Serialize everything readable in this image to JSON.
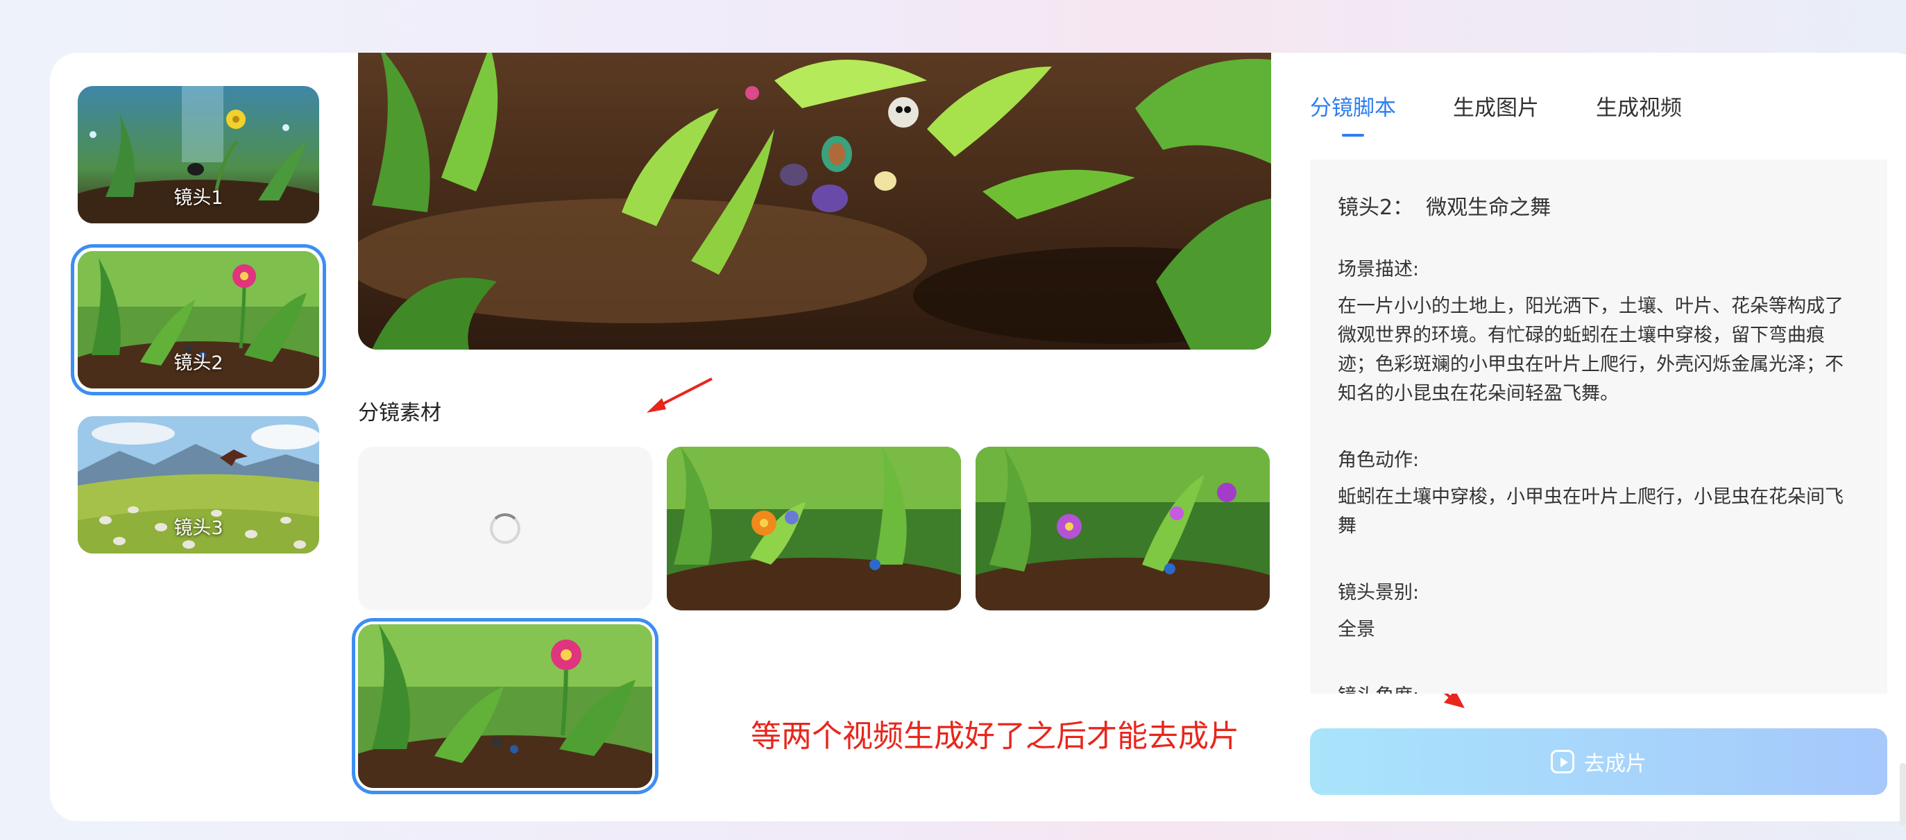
{
  "shots": [
    {
      "label": "镜头1"
    },
    {
      "label": "镜头2"
    },
    {
      "label": "镜头3"
    }
  ],
  "materials": {
    "title": "分镜素材"
  },
  "annotation": {
    "note": "等两个视频生成好了之后才能去成片",
    "color": "#e8261c"
  },
  "tabs": [
    {
      "label": "分镜脚本",
      "active": true
    },
    {
      "label": "生成图片",
      "active": false
    },
    {
      "label": "生成视频",
      "active": false
    }
  ],
  "script": {
    "shot_prefix": "镜头2：",
    "shot_name": "微观生命之舞",
    "scene_label": "场景描述:",
    "scene_text": "在一片小小的土地上，阳光洒下，土壤、叶片、花朵等构成了微观世界的环境。有忙碌的蚯蚓在土壤中穿梭，留下弯曲痕迹；色彩斑斓的小甲虫在叶片上爬行，外壳闪烁金属光泽；不知名的小昆虫在花朵间轻盈飞舞。",
    "action_label": "角色动作:",
    "action_text": "蚯蚓在土壤中穿梭，小甲虫在叶片上爬行，小昆虫在花朵间飞舞",
    "view_label": "镜头景别:",
    "view_text": "全景",
    "angle_label": "镜头角度:"
  },
  "actions": {
    "go_label": "去成片"
  },
  "colors": {
    "accent": "#2f7ef0",
    "selection_outline": "#3d8ef2"
  }
}
